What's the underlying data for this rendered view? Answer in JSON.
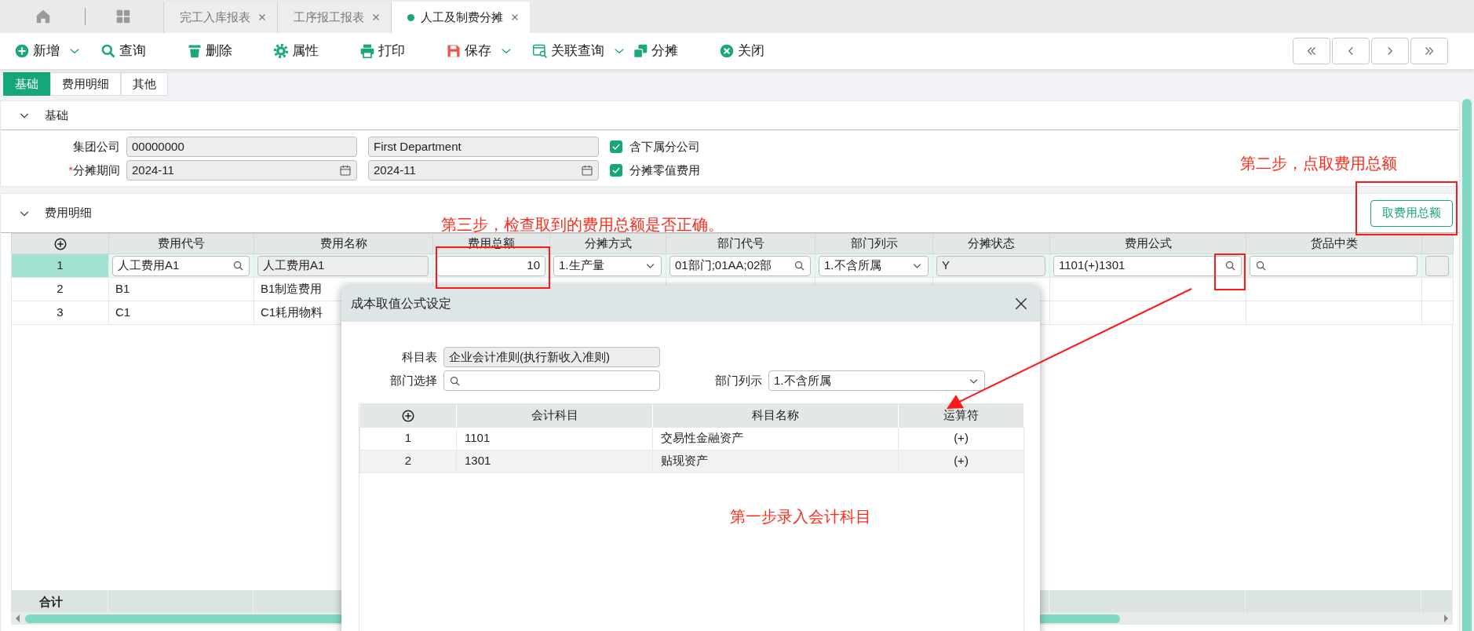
{
  "tabs": [
    {
      "label": "完工入库报表",
      "selected": false
    },
    {
      "label": "工序报工报表",
      "selected": false
    },
    {
      "label": "人工及制费分摊",
      "selected": true
    }
  ],
  "toolbar": [
    {
      "label": "新增",
      "dropdown": true
    },
    {
      "label": "查询",
      "dropdown": false
    },
    {
      "label": "删除",
      "dropdown": false
    },
    {
      "label": "属性",
      "dropdown": false
    },
    {
      "label": "打印",
      "dropdown": false
    },
    {
      "label": "保存",
      "dropdown": true
    },
    {
      "label": "关联查询",
      "dropdown": true
    },
    {
      "label": "分摊",
      "dropdown": false
    },
    {
      "label": "关闭",
      "dropdown": false
    }
  ],
  "subtabs": [
    {
      "label": "基础",
      "selected": true
    },
    {
      "label": "费用明细",
      "selected": false
    },
    {
      "label": "其他",
      "selected": false
    }
  ],
  "basic_section": {
    "title": "基础",
    "expanded": true,
    "rows": [
      {
        "label": "集团公司",
        "kind": "text",
        "values": [
          "00000000",
          "First Department"
        ],
        "checkbox": {
          "label": "含下属分公司",
          "checked": true
        }
      },
      {
        "label": "分摊期间",
        "required_mark": "*",
        "kind": "date",
        "values": [
          "2024-11",
          "2024-11"
        ],
        "checkbox": {
          "label": "分摊零值费用",
          "checked": true
        }
      }
    ]
  },
  "detail_section": {
    "title": "费用明细",
    "expanded": true,
    "button": "取费用总额",
    "columns": [
      "费用代号",
      "费用名称",
      "费用总额",
      "分摊方式",
      "部门代号",
      "部门列示",
      "分摊状态",
      "费用公式",
      "货品中类"
    ],
    "rows": [
      {
        "index": "1",
        "selected": true,
        "cells": [
          {
            "kind": "lookup",
            "value": "人工费用A1"
          },
          {
            "kind": "readonly",
            "value": "人工费用A1"
          },
          {
            "kind": "number",
            "value": "10"
          },
          {
            "kind": "select",
            "value": "1.生产量"
          },
          {
            "kind": "lookup",
            "value": "01部门;01AA;02部"
          },
          {
            "kind": "select",
            "value": "1.不含所属"
          },
          {
            "kind": "readonly",
            "value": "Y"
          },
          {
            "kind": "lookup",
            "value": "1101(+)1301"
          },
          {
            "kind": "lookup"
          },
          {
            "kind": "readonly"
          }
        ]
      },
      {
        "index": "2",
        "selected": false,
        "cells": [
          {
            "kind": "text",
            "value": "B1"
          },
          {
            "kind": "text",
            "value": "B1制造费用"
          }
        ]
      },
      {
        "index": "3",
        "selected": false,
        "cells": [
          {
            "kind": "text",
            "value": "C1"
          },
          {
            "kind": "text",
            "value": "C1耗用物料"
          }
        ]
      }
    ],
    "footer_label": "合计"
  },
  "dialog": {
    "title": "成本取值公式设定",
    "fields": [
      {
        "label": "科目表",
        "kind": "readonly",
        "value": "企业会计准则(执行新收入准则)"
      },
      {
        "label": "部门选择",
        "kind": "lookup"
      },
      {
        "label": "部门列示",
        "kind": "select",
        "value": "1.不含所属"
      }
    ],
    "columns": [
      "会计科目",
      "科目名称",
      "运算符"
    ],
    "rows": [
      {
        "index": "1",
        "cells": [
          "1101",
          "交易性金融资产",
          "(+)"
        ]
      },
      {
        "index": "2",
        "cells": [
          "1301",
          "贴现资产",
          "(+)"
        ]
      }
    ]
  },
  "annotations": [
    {
      "text": "第二步，点取费用总额"
    },
    {
      "text": "第三步，检查取到的费用总额是否正确。"
    },
    {
      "text": "第一步录入会计科目"
    }
  ]
}
